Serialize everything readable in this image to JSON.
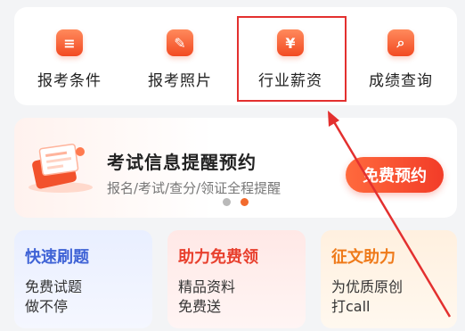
{
  "quick_actions": [
    {
      "label": "报考条件",
      "icon": "list-document-icon",
      "glyph": "≡"
    },
    {
      "label": "报考照片",
      "icon": "photo-icon",
      "glyph": "✎"
    },
    {
      "label": "行业薪资",
      "icon": "yen-icon",
      "glyph": "¥"
    },
    {
      "label": "成绩查询",
      "icon": "search-icon",
      "glyph": "⌕"
    }
  ],
  "banner": {
    "title": "考试信息提醒预约",
    "subtitle": "报名/考试/查分/领证全程提醒",
    "button": "免费预约",
    "page_dots": 2,
    "active_dot": 2
  },
  "features": [
    {
      "title": "快速刷题",
      "line1": "免费试题",
      "line2": "做不停"
    },
    {
      "title": "助力免费领",
      "line1": "精品资料",
      "line2": "免费送"
    },
    {
      "title": "征文助力",
      "line1": "为优质原创",
      "line2": "打call"
    }
  ],
  "colors": {
    "accent": "#f24a22",
    "highlight_box": "#e3302f",
    "blue": "#3f63d6",
    "orange": "#ef7a1a"
  }
}
